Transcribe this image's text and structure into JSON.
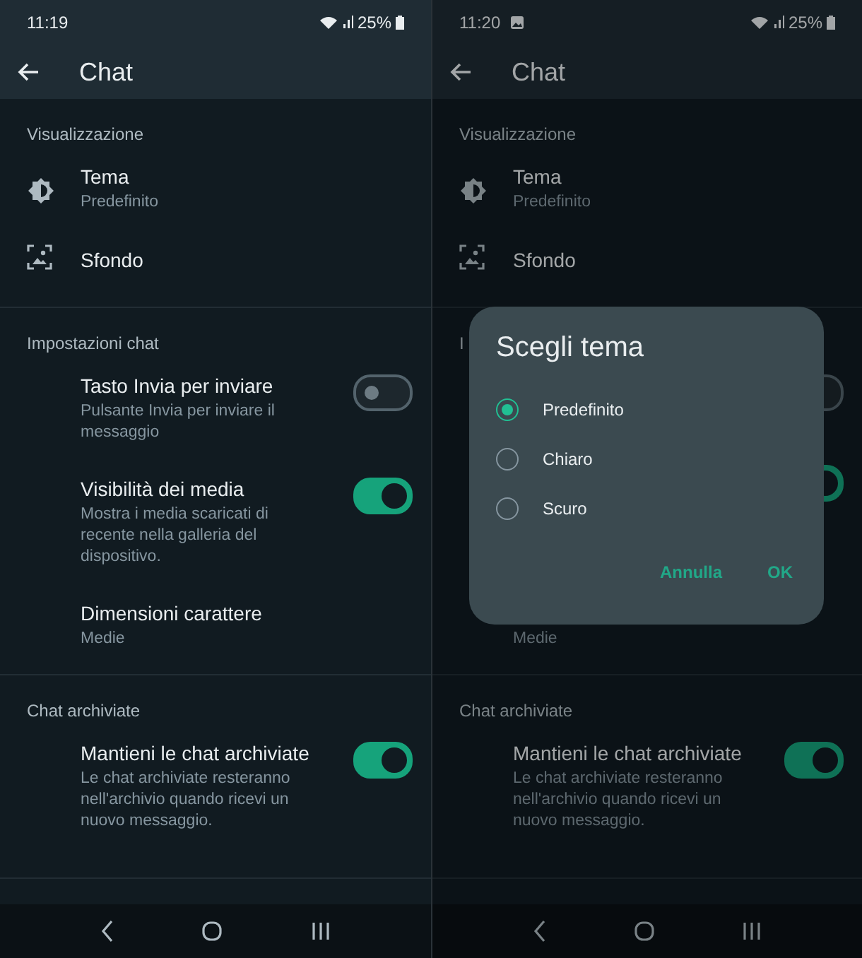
{
  "screens": [
    {
      "status": {
        "time": "11:19",
        "notification": false,
        "battery": "25%"
      },
      "title": "Chat",
      "dimmed": false,
      "sections": [
        {
          "header": "Visualizzazione",
          "items": [
            {
              "kind": "theme",
              "title": "Tema",
              "subtitle": "Predefinito"
            },
            {
              "kind": "wallpaper",
              "title": "Sfondo"
            }
          ]
        },
        {
          "header": "Impostazioni chat",
          "items": [
            {
              "kind": "toggle",
              "title": "Tasto Invia per inviare",
              "subtitle": "Pulsante Invia per inviare il messaggio",
              "on": false
            },
            {
              "kind": "toggle",
              "title": "Visibilità dei media",
              "subtitle": "Mostra i media scaricati di recente nella galleria del dispositivo.",
              "on": true
            },
            {
              "kind": "plain",
              "title": "Dimensioni carattere",
              "subtitle": "Medie"
            }
          ]
        },
        {
          "header": "Chat archiviate",
          "items": [
            {
              "kind": "toggle",
              "title": "Mantieni le chat archiviate",
              "subtitle": "Le chat archiviate resteranno nell'archivio quando ricevi un nuovo messaggio.",
              "on": true
            }
          ]
        }
      ]
    },
    {
      "status": {
        "time": "11:20",
        "notification": true,
        "battery": "25%"
      },
      "title": "Chat",
      "dimmed": true,
      "sections": [
        {
          "header": "Visualizzazione",
          "items": [
            {
              "kind": "theme",
              "title": "Tema",
              "subtitle": "Predefinito"
            },
            {
              "kind": "wallpaper",
              "title": "Sfondo"
            }
          ]
        },
        {
          "header": "I",
          "items": [
            {
              "kind": "toggle",
              "on": false
            },
            {
              "kind": "toggle",
              "on": true
            },
            {
              "kind": "plain",
              "subtitle": "Medie"
            }
          ]
        },
        {
          "header": "Chat archiviate",
          "items": [
            {
              "kind": "toggle",
              "title": "Mantieni le chat archiviate",
              "subtitle": "Le chat archiviate resteranno nell'archivio quando ricevi un nuovo messaggio.",
              "on": true
            }
          ]
        }
      ],
      "dialog": {
        "title": "Scegli tema",
        "options": [
          {
            "label": "Predefinito",
            "selected": true
          },
          {
            "label": "Chiaro",
            "selected": false
          },
          {
            "label": "Scuro",
            "selected": false
          }
        ],
        "buttons": [
          "Annulla",
          "OK"
        ]
      }
    }
  ]
}
